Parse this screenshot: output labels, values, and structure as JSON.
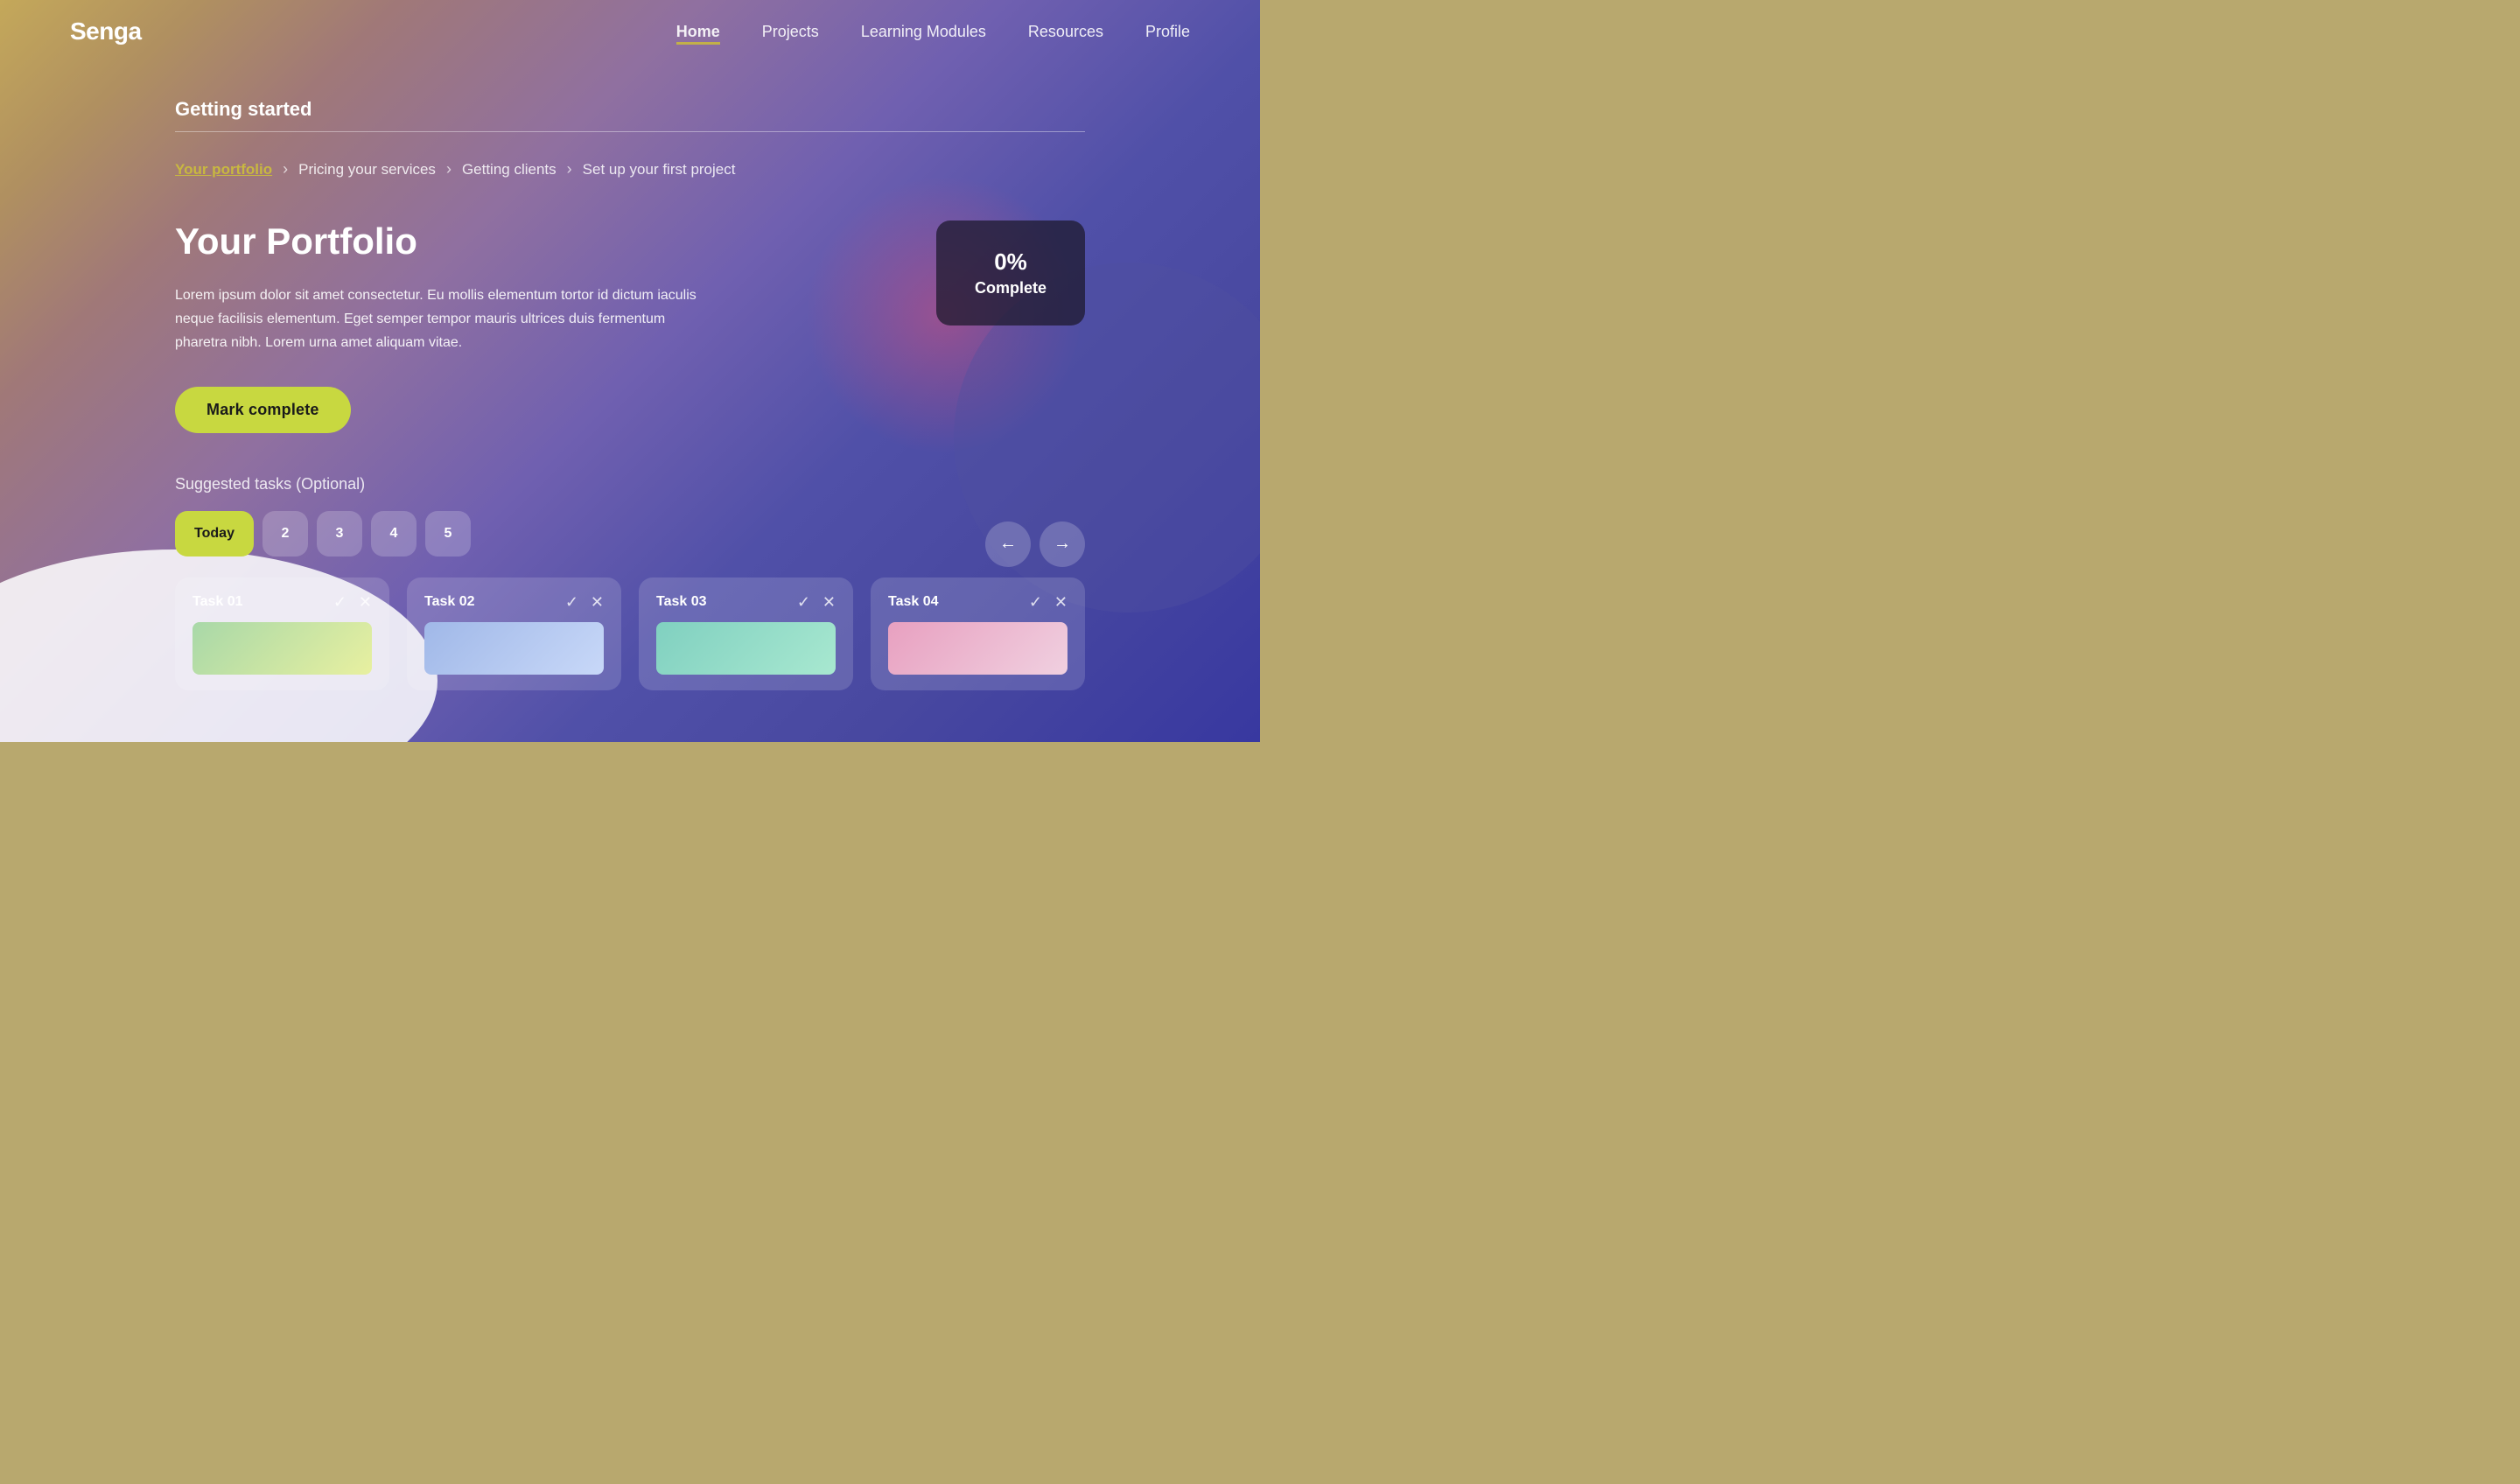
{
  "brand": "Senga",
  "nav": {
    "links": [
      {
        "label": "Home",
        "active": true
      },
      {
        "label": "Projects",
        "active": false
      },
      {
        "label": "Learning Modules",
        "active": false
      },
      {
        "label": "Resources",
        "active": false
      },
      {
        "label": "Profile",
        "active": false
      }
    ]
  },
  "section": {
    "title": "Getting started"
  },
  "breadcrumb": {
    "items": [
      {
        "label": "Your portfolio",
        "active": true
      },
      {
        "label": "Pricing your services",
        "active": false
      },
      {
        "label": "Getting clients",
        "active": false
      },
      {
        "label": "Set up your first project",
        "active": false
      }
    ]
  },
  "portfolio": {
    "title": "Your Portfolio",
    "description": "Lorem ipsum dolor sit amet consectetur. Eu mollis elementum tortor id dictum iaculis neque facilisis elementum. Eget semper tempor mauris ultrices duis fermentum pharetra nibh. Lorem urna amet aliquam vitae.",
    "mark_complete_label": "Mark complete",
    "progress": {
      "percent": "0%",
      "label": "Complete"
    }
  },
  "suggested": {
    "title": "Suggested tasks (Optional)",
    "tabs": [
      {
        "label": "Today",
        "active": true
      },
      {
        "label": "2",
        "active": false
      },
      {
        "label": "3",
        "active": false
      },
      {
        "label": "4",
        "active": false
      },
      {
        "label": "5",
        "active": false
      }
    ],
    "prev_arrow": "←",
    "next_arrow": "→",
    "tasks": [
      {
        "title": "Task 01",
        "color": "card-green"
      },
      {
        "title": "Task 02",
        "color": "card-blue"
      },
      {
        "title": "Task 03",
        "color": "card-teal"
      },
      {
        "title": "Task 04",
        "color": "card-pink"
      }
    ]
  }
}
